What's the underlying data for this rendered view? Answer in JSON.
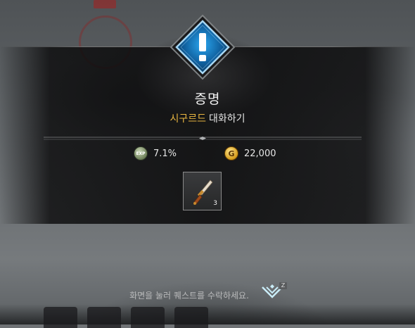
{
  "quest": {
    "title": "증명",
    "npc_name": "시구르드",
    "action": "대화하기"
  },
  "rewards": {
    "exp_label": "EXP",
    "exp_value": "7.1%",
    "gold_symbol": "G",
    "gold_value": "22,000"
  },
  "item": {
    "count": "3"
  },
  "footer": {
    "hint": "화면을 눌러 퀘스트를 수락하세요.",
    "key_label": "Z"
  },
  "colors": {
    "npc_name": "#e8b540",
    "quest_icon_blue": "#1f8fd6"
  },
  "icons": {
    "quest": "exclamation-diamond-icon",
    "exp": "exp-coin-icon",
    "gold": "gold-coin-icon",
    "item": "dagger-icon",
    "accept": "accept-chevron-icon"
  }
}
